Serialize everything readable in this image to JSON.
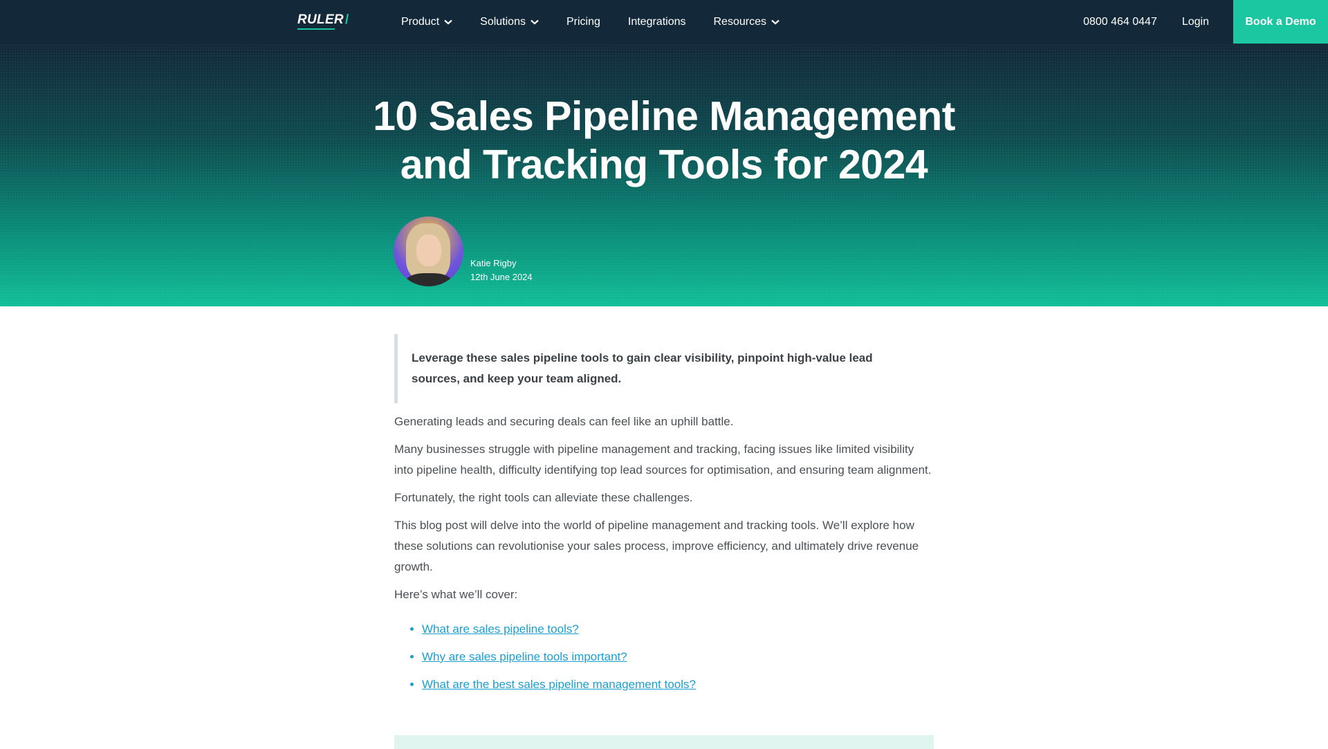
{
  "nav": {
    "logo": "RULER",
    "logo_slash": "/",
    "items": [
      {
        "label": "Product",
        "has_dropdown": true
      },
      {
        "label": "Solutions",
        "has_dropdown": true
      },
      {
        "label": "Pricing",
        "has_dropdown": false
      },
      {
        "label": "Integrations",
        "has_dropdown": false
      },
      {
        "label": "Resources",
        "has_dropdown": true
      }
    ],
    "phone": "0800 464 0447",
    "login": "Login",
    "cta": "Book a Demo"
  },
  "hero": {
    "title_line1": "10 Sales Pipeline Management",
    "title_line2": "and Tracking Tools for 2024",
    "author": "Katie Rigby",
    "date": "12th June 2024"
  },
  "article": {
    "intro_quote": "Leverage these sales pipeline tools to gain clear visibility, pinpoint high-value lead sources, and keep your team aligned.",
    "paragraphs": [
      "Generating leads and securing deals can feel like an uphill battle.",
      "Many businesses struggle with pipeline management and tracking, facing issues like limited visibility into pipeline health, difficulty identifying top lead sources for optimisation, and ensuring team alignment.",
      "Fortunately, the right tools can alleviate these challenges.",
      "This blog post will delve into the world of pipeline management and tracking tools. We’ll explore how these solutions can revolutionise your sales process, improve efficiency, and ultimately drive revenue growth.",
      "Here’s what we’ll cover:"
    ],
    "toc": [
      "What are sales pipeline tools?",
      "Why are sales pipeline tools important?",
      "What are the best sales pipeline management tools?"
    ]
  },
  "colors": {
    "nav_bg": "#13293a",
    "accent": "#1ac7a1",
    "link": "#1a9fd4"
  }
}
